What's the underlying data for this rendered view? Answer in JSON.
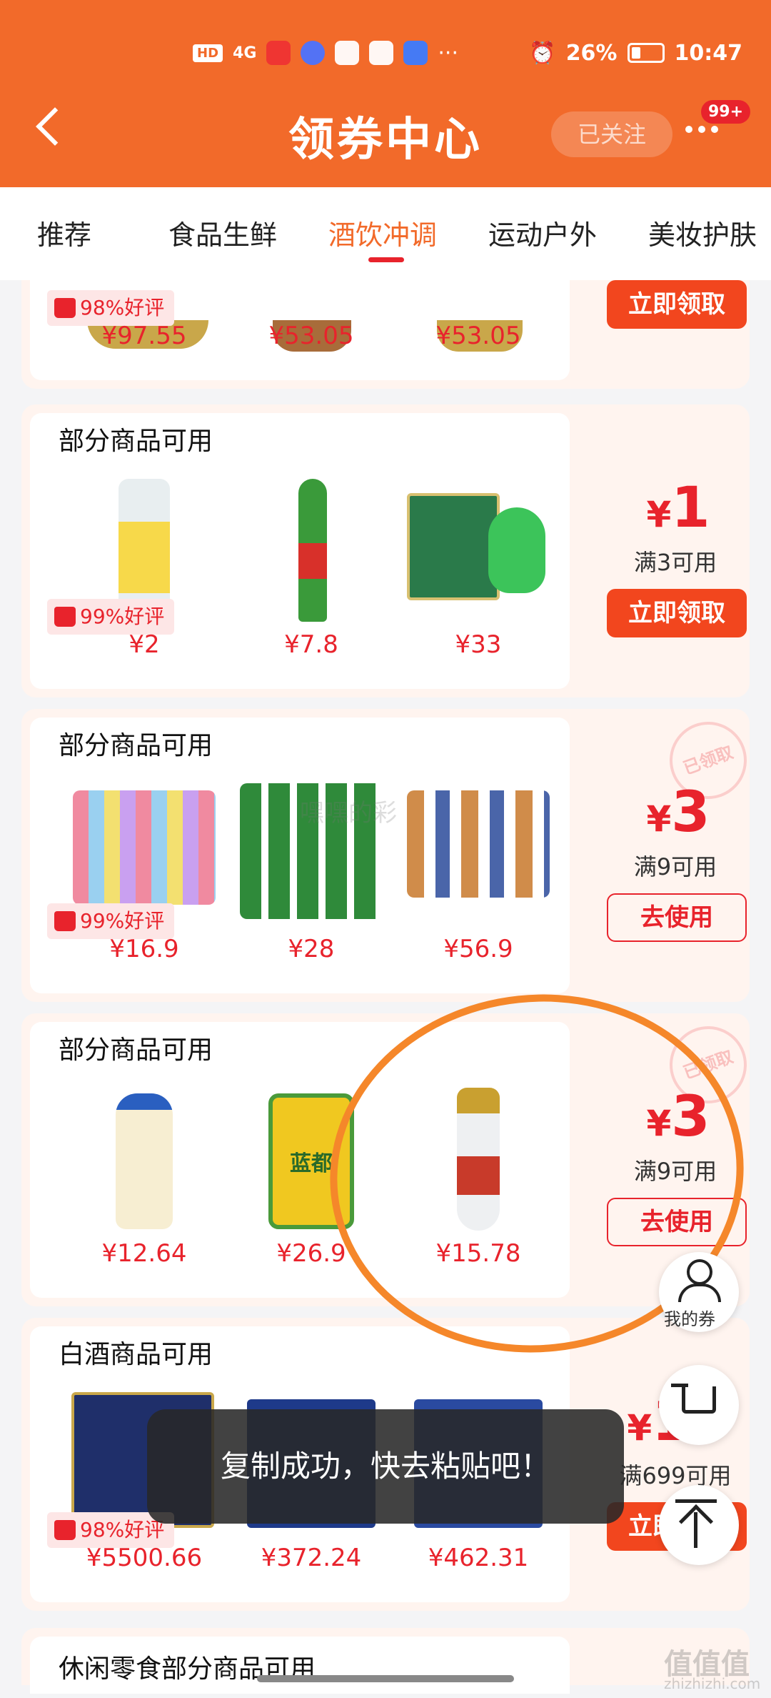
{
  "status": {
    "hd": "HD",
    "signal": "4G",
    "battery": "26%",
    "time": "10:47"
  },
  "header": {
    "title": "领券中心",
    "follow_label": "已关注",
    "badge": "99+"
  },
  "tabs": [
    "推荐",
    "食品生鲜",
    "酒饮冲调",
    "运动户外",
    "美妆护肤"
  ],
  "active_tab": "酒饮冲调",
  "cards": [
    {
      "availability": "",
      "rating": "98%好评",
      "prices": [
        "¥97.55",
        "¥53.05",
        "¥53.05"
      ],
      "button": "立即领取"
    },
    {
      "availability": "部分商品可用",
      "rating": "99%好评",
      "prices": [
        "¥2",
        "¥7.8",
        "¥33"
      ],
      "amount_currency": "¥",
      "amount": "1",
      "condition": "满3可用",
      "button": "立即领取"
    },
    {
      "availability": "部分商品可用",
      "rating": "99%好评",
      "prices": [
        "¥16.9",
        "¥28",
        "¥56.9"
      ],
      "amount_currency": "¥",
      "amount": "3",
      "condition": "满9可用",
      "button": "去使用",
      "stamp": "已领取"
    },
    {
      "availability": "部分商品可用",
      "prices": [
        "¥12.64",
        "¥26.9",
        "¥15.78"
      ],
      "amount_currency": "¥",
      "amount": "3",
      "condition": "满9可用",
      "button": "去使用",
      "stamp": "已领取"
    },
    {
      "availability": "白酒商品可用",
      "rating": "98%好评",
      "prices": [
        "¥5500.66",
        "¥372.24",
        "¥462.31"
      ],
      "amount_currency": "¥",
      "amount": "10",
      "condition": "满699可用",
      "button": "立即领取"
    }
  ],
  "partial_card": {
    "availability": "休闲零食部分商品可用"
  },
  "product_labels": {
    "lanzhou_can": "蓝都"
  },
  "floating": {
    "my_coupons": "我的券"
  },
  "toast": "复制成功，快去粘贴吧！",
  "watermark": {
    "center": "嘿嘿的彩",
    "corner": "值值值",
    "corner_url": "zhizhizhi.com"
  }
}
